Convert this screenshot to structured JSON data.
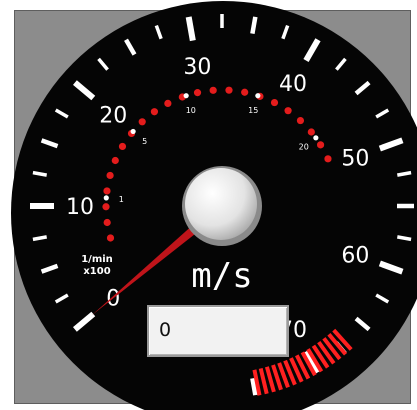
{
  "gauge": {
    "unit_label": "m/s",
    "rpm_unit_line1": "1/min",
    "rpm_unit_line2": "x100",
    "speed_labels": [
      "0",
      "10",
      "20",
      "30",
      "40",
      "50",
      "60",
      "70"
    ],
    "rpm_labels": [
      "1",
      "5",
      "10",
      "15",
      "20"
    ],
    "current_value": "0",
    "speed_min": 0,
    "speed_max": 75,
    "red_zone_start": 67,
    "colors": {
      "dial": "#050505",
      "tick": "#ffffff",
      "rpm_dot": "#e41c1c",
      "red_zone": "#ff2020",
      "needle": "#c0141a",
      "hub": "#e6e6e6"
    }
  },
  "readout": {
    "value": "0"
  }
}
